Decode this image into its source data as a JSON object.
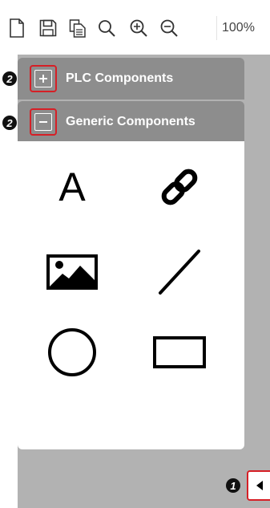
{
  "toolbar": {
    "buttons": [
      {
        "icon": "new-document-icon"
      },
      {
        "icon": "save-icon"
      },
      {
        "icon": "copy-icon"
      },
      {
        "icon": "search-icon"
      },
      {
        "icon": "zoom-in-icon"
      },
      {
        "icon": "zoom-out-icon"
      }
    ],
    "zoom_value": "100%"
  },
  "panel": {
    "sections": [
      {
        "label": "PLC Components",
        "toggle": "+",
        "expanded": false
      },
      {
        "label": "Generic Components",
        "toggle": "−",
        "expanded": true
      }
    ],
    "generic_components": [
      {
        "icon": "text-icon",
        "glyph": "A"
      },
      {
        "icon": "link-icon"
      },
      {
        "icon": "image-icon"
      },
      {
        "icon": "line-icon"
      },
      {
        "icon": "circle-icon"
      },
      {
        "icon": "rectangle-icon"
      }
    ]
  },
  "callouts": {
    "collapse": "1",
    "plc_section": "2",
    "generic_section": "2"
  },
  "colors": {
    "header_bg": "#8d8d8d",
    "panel_bg": "#b2b2b2",
    "highlight": "#d61f26"
  }
}
